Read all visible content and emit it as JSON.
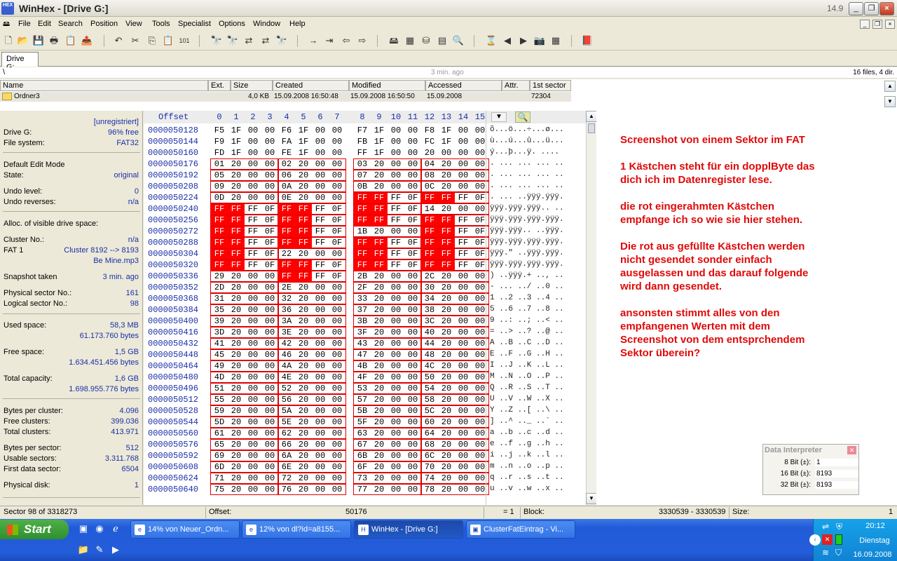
{
  "window": {
    "title": "WinHex - [Drive G:]",
    "version": "14.9",
    "app_icon_text": "HEX"
  },
  "menu": [
    "File",
    "Edit",
    "Search",
    "Position",
    "View",
    "Tools",
    "Specialist",
    "Options",
    "Window",
    "Help"
  ],
  "tab": "Drive G:",
  "pathbar": {
    "path": "\\",
    "time": "3 min. ago",
    "count": "16 files, 4 dir."
  },
  "filelist": {
    "headers": [
      "Name",
      "Ext.",
      "Size",
      "Created",
      "Modified",
      "Accessed",
      "Attr.",
      "1st sector"
    ],
    "row": {
      "name": "Ordner3",
      "size": "4,0 KB",
      "created": "15.09.2008  16:50:48",
      "modified": "15.09.2008  16:50:50",
      "accessed": "15.09.2008",
      "first_sector": "72304"
    }
  },
  "info": {
    "unregistered": "[unregistriert]",
    "drive_label": "Drive G:",
    "drive_free": "96% free",
    "fs_label": "File system:",
    "fs_value": "FAT32",
    "edit_mode": "Default Edit Mode",
    "state_label": "State:",
    "state_value": "original",
    "undo_level_label": "Undo level:",
    "undo_level": "0",
    "undo_rev_label": "Undo reverses:",
    "undo_rev": "n/a",
    "alloc": "Alloc. of visible drive space:",
    "cluster_no_label": "Cluster No.:",
    "cluster_no": "n/a",
    "fat1_label": "FAT 1",
    "fat1_value": "Cluster 8192 --> 8193",
    "fat1_file": "Be Mine.mp3",
    "snapshot_label": "Snapshot taken",
    "snapshot_value": "3 min. ago",
    "phys_label": "Physical sector No.:",
    "phys_value": "161",
    "log_label": "Logical sector No.:",
    "log_value": "98",
    "used_label": "Used space:",
    "used_1": "58,3 MB",
    "used_2": "61.173.760 bytes",
    "free_label": "Free space:",
    "free_1": "1,5 GB",
    "free_2": "1.634.451.456 bytes",
    "total_label": "Total capacity:",
    "total_1": "1,6 GB",
    "total_2": "1.698.955.776 bytes",
    "bpc_label": "Bytes per cluster:",
    "bpc": "4.096",
    "fc_label": "Free clusters:",
    "fc": "399.036",
    "tc_label": "Total clusters:",
    "tc": "413.971",
    "bps_label": "Bytes per sector:",
    "bps": "512",
    "us_label": "Usable sectors:",
    "us": "3.311.768",
    "fds_label": "First data sector:",
    "fds": "6504",
    "pd_label": "Physical disk:",
    "pd": "1"
  },
  "hex": {
    "offset_label": "Offset",
    "columns": [
      "0",
      "1",
      "2",
      "3",
      "4",
      "5",
      "6",
      "7",
      "8",
      "9",
      "10",
      "11",
      "12",
      "13",
      "14",
      "15"
    ],
    "rows": [
      {
        "off": "0000050128",
        "b": [
          "F5",
          "1F",
          "00",
          "00",
          "F6",
          "1F",
          "00",
          "00",
          "F7",
          "1F",
          "00",
          "00",
          "F8",
          "1F",
          "00",
          "00"
        ],
        "t": "õ...ö...÷...ø..."
      },
      {
        "off": "0000050144",
        "b": [
          "F9",
          "1F",
          "00",
          "00",
          "FA",
          "1F",
          "00",
          "00",
          "FB",
          "1F",
          "00",
          "00",
          "FC",
          "1F",
          "00",
          "00"
        ],
        "t": "ù...ú...û...ü..."
      },
      {
        "off": "0000050160",
        "b": [
          "FD",
          "1F",
          "00",
          "00",
          "FE",
          "1F",
          "00",
          "00",
          "FF",
          "1F",
          "00",
          "00",
          "20",
          "00",
          "00",
          "00"
        ],
        "t": "ý...þ...ÿ. ...."
      },
      {
        "off": "0000050176",
        "b": [
          "01",
          "20",
          "00",
          "00",
          "02",
          "20",
          "00",
          "00",
          "03",
          "20",
          "00",
          "00",
          "04",
          "20",
          "00",
          "00"
        ],
        "t": ". ... ... ... .."
      },
      {
        "off": "0000050192",
        "b": [
          "05",
          "20",
          "00",
          "00",
          "06",
          "20",
          "00",
          "00",
          "07",
          "20",
          "00",
          "00",
          "08",
          "20",
          "00",
          "00"
        ],
        "t": ". ... ... ... .."
      },
      {
        "off": "0000050208",
        "b": [
          "09",
          "20",
          "00",
          "00",
          "0A",
          "20",
          "00",
          "00",
          "0B",
          "20",
          "00",
          "00",
          "0C",
          "20",
          "00",
          "00"
        ],
        "t": ". ... ... ... .."
      },
      {
        "off": "0000050224",
        "b": [
          "0D",
          "20",
          "00",
          "00",
          "0E",
          "20",
          "00",
          "00",
          "FF",
          "FF",
          "FF",
          "0F",
          "FF",
          "FF",
          "FF",
          "0F"
        ],
        "t": ". ... ..ÿÿÿ.ÿÿÿ."
      },
      {
        "off": "0000050240",
        "b": [
          "FF",
          "FF",
          "FF",
          "0F",
          "FF",
          "FF",
          "FF",
          "0F",
          "FF",
          "FF",
          "FF",
          "0F",
          "14",
          "20",
          "00",
          "00"
        ],
        "t": "ÿÿÿ.ÿÿÿ.ÿÿÿ.. .."
      },
      {
        "off": "0000050256",
        "b": [
          "FF",
          "FF",
          "FF",
          "0F",
          "FF",
          "FF",
          "FF",
          "0F",
          "FF",
          "FF",
          "FF",
          "0F",
          "FF",
          "FF",
          "FF",
          "0F"
        ],
        "t": "ÿÿÿ.ÿÿÿ.ÿÿÿ.ÿÿÿ."
      },
      {
        "off": "0000050272",
        "b": [
          "FF",
          "FF",
          "FF",
          "0F",
          "FF",
          "FF",
          "FF",
          "0F",
          "1B",
          "20",
          "00",
          "00",
          "FF",
          "FF",
          "FF",
          "0F"
        ],
        "t": "ÿÿÿ.ÿÿÿ.. ..ÿÿÿ."
      },
      {
        "off": "0000050288",
        "b": [
          "FF",
          "FF",
          "FF",
          "0F",
          "FF",
          "FF",
          "FF",
          "0F",
          "FF",
          "FF",
          "FF",
          "0F",
          "FF",
          "FF",
          "FF",
          "0F"
        ],
        "t": "ÿÿÿ.ÿÿÿ.ÿÿÿ.ÿÿÿ."
      },
      {
        "off": "0000050304",
        "b": [
          "FF",
          "FF",
          "FF",
          "0F",
          "22",
          "20",
          "00",
          "00",
          "FF",
          "FF",
          "FF",
          "0F",
          "FF",
          "FF",
          "FF",
          "0F"
        ],
        "t": "ÿÿÿ.\" ..ÿÿÿ.ÿÿÿ."
      },
      {
        "off": "0000050320",
        "b": [
          "FF",
          "FF",
          "FF",
          "0F",
          "FF",
          "FF",
          "FF",
          "0F",
          "FF",
          "FF",
          "FF",
          "0F",
          "FF",
          "FF",
          "FF",
          "0F"
        ],
        "t": "ÿÿÿ.ÿÿÿ.ÿÿÿ.ÿÿÿ."
      },
      {
        "off": "0000050336",
        "b": [
          "29",
          "20",
          "00",
          "00",
          "FF",
          "FF",
          "FF",
          "0F",
          "2B",
          "20",
          "00",
          "00",
          "2C",
          "20",
          "00",
          "00"
        ],
        "t": ") ..ÿÿÿ.+ .., .."
      },
      {
        "off": "0000050352",
        "b": [
          "2D",
          "20",
          "00",
          "00",
          "2E",
          "20",
          "00",
          "00",
          "2F",
          "20",
          "00",
          "00",
          "30",
          "20",
          "00",
          "00"
        ],
        "t": "- ... ../ ..0 .."
      },
      {
        "off": "0000050368",
        "b": [
          "31",
          "20",
          "00",
          "00",
          "32",
          "20",
          "00",
          "00",
          "33",
          "20",
          "00",
          "00",
          "34",
          "20",
          "00",
          "00"
        ],
        "t": "1 ..2 ..3 ..4 .."
      },
      {
        "off": "0000050384",
        "b": [
          "35",
          "20",
          "00",
          "00",
          "36",
          "20",
          "00",
          "00",
          "37",
          "20",
          "00",
          "00",
          "38",
          "20",
          "00",
          "00"
        ],
        "t": "5 ..6 ..7 ..8 .."
      },
      {
        "off": "0000050400",
        "b": [
          "39",
          "20",
          "00",
          "00",
          "3A",
          "20",
          "00",
          "00",
          "3B",
          "20",
          "00",
          "00",
          "3C",
          "20",
          "00",
          "00"
        ],
        "t": "9 ..: ..; ..< .."
      },
      {
        "off": "0000050416",
        "b": [
          "3D",
          "20",
          "00",
          "00",
          "3E",
          "20",
          "00",
          "00",
          "3F",
          "20",
          "00",
          "00",
          "40",
          "20",
          "00",
          "00"
        ],
        "t": "= ..> ..? ..@ .."
      },
      {
        "off": "0000050432",
        "b": [
          "41",
          "20",
          "00",
          "00",
          "42",
          "20",
          "00",
          "00",
          "43",
          "20",
          "00",
          "00",
          "44",
          "20",
          "00",
          "00"
        ],
        "t": "A ..B ..C ..D .."
      },
      {
        "off": "0000050448",
        "b": [
          "45",
          "20",
          "00",
          "00",
          "46",
          "20",
          "00",
          "00",
          "47",
          "20",
          "00",
          "00",
          "48",
          "20",
          "00",
          "00"
        ],
        "t": "E ..F ..G ..H .."
      },
      {
        "off": "0000050464",
        "b": [
          "49",
          "20",
          "00",
          "00",
          "4A",
          "20",
          "00",
          "00",
          "4B",
          "20",
          "00",
          "00",
          "4C",
          "20",
          "00",
          "00"
        ],
        "t": "I ..J ..K ..L .."
      },
      {
        "off": "0000050480",
        "b": [
          "4D",
          "20",
          "00",
          "00",
          "4E",
          "20",
          "00",
          "00",
          "4F",
          "20",
          "00",
          "00",
          "50",
          "20",
          "00",
          "00"
        ],
        "t": "M ..N ..O ..P .."
      },
      {
        "off": "0000050496",
        "b": [
          "51",
          "20",
          "00",
          "00",
          "52",
          "20",
          "00",
          "00",
          "53",
          "20",
          "00",
          "00",
          "54",
          "20",
          "00",
          "00"
        ],
        "t": "Q ..R ..S ..T .."
      },
      {
        "off": "0000050512",
        "b": [
          "55",
          "20",
          "00",
          "00",
          "56",
          "20",
          "00",
          "00",
          "57",
          "20",
          "00",
          "00",
          "58",
          "20",
          "00",
          "00"
        ],
        "t": "U ..V ..W ..X .."
      },
      {
        "off": "0000050528",
        "b": [
          "59",
          "20",
          "00",
          "00",
          "5A",
          "20",
          "00",
          "00",
          "5B",
          "20",
          "00",
          "00",
          "5C",
          "20",
          "00",
          "00"
        ],
        "t": "Y ..Z ..[ ..\\ .."
      },
      {
        "off": "0000050544",
        "b": [
          "5D",
          "20",
          "00",
          "00",
          "5E",
          "20",
          "00",
          "00",
          "5F",
          "20",
          "00",
          "00",
          "60",
          "20",
          "00",
          "00"
        ],
        "t": "] ..^ .._ ..` .."
      },
      {
        "off": "0000050560",
        "b": [
          "61",
          "20",
          "00",
          "00",
          "62",
          "20",
          "00",
          "00",
          "63",
          "20",
          "00",
          "00",
          "64",
          "20",
          "00",
          "00"
        ],
        "t": "a ..b ..c ..d .."
      },
      {
        "off": "0000050576",
        "b": [
          "65",
          "20",
          "00",
          "00",
          "66",
          "20",
          "00",
          "00",
          "67",
          "20",
          "00",
          "00",
          "68",
          "20",
          "00",
          "00"
        ],
        "t": "e ..f ..g ..h .."
      },
      {
        "off": "0000050592",
        "b": [
          "69",
          "20",
          "00",
          "00",
          "6A",
          "20",
          "00",
          "00",
          "6B",
          "20",
          "00",
          "00",
          "6C",
          "20",
          "00",
          "00"
        ],
        "t": "i ..j ..k ..l .."
      },
      {
        "off": "0000050608",
        "b": [
          "6D",
          "20",
          "00",
          "00",
          "6E",
          "20",
          "00",
          "00",
          "6F",
          "20",
          "00",
          "00",
          "70",
          "20",
          "00",
          "00"
        ],
        "t": "m ..n ..o ..p .."
      },
      {
        "off": "0000050624",
        "b": [
          "71",
          "20",
          "00",
          "00",
          "72",
          "20",
          "00",
          "00",
          "73",
          "20",
          "00",
          "00",
          "74",
          "20",
          "00",
          "00"
        ],
        "t": "q ..r ..s ..t .."
      },
      {
        "off": "0000050640",
        "b": [
          "75",
          "20",
          "00",
          "00",
          "76",
          "20",
          "00",
          "00",
          "77",
          "20",
          "00",
          "00",
          "78",
          "20",
          "00",
          "00"
        ],
        "t": "u ..v ..w ..x .."
      }
    ],
    "filled_bytes": [
      [
        6,
        8
      ],
      [
        6,
        9
      ],
      [
        6,
        12
      ],
      [
        6,
        13
      ],
      [
        7,
        0
      ],
      [
        7,
        1
      ],
      [
        7,
        4
      ],
      [
        7,
        5
      ],
      [
        7,
        8
      ],
      [
        7,
        9
      ],
      [
        8,
        0
      ],
      [
        8,
        1
      ],
      [
        8,
        4
      ],
      [
        8,
        5
      ],
      [
        8,
        8
      ],
      [
        8,
        9
      ],
      [
        8,
        12
      ],
      [
        8,
        13
      ],
      [
        9,
        0
      ],
      [
        9,
        1
      ],
      [
        9,
        4
      ],
      [
        9,
        5
      ],
      [
        9,
        12
      ],
      [
        9,
        13
      ],
      [
        10,
        0
      ],
      [
        10,
        1
      ],
      [
        10,
        4
      ],
      [
        10,
        5
      ],
      [
        10,
        8
      ],
      [
        10,
        9
      ],
      [
        10,
        12
      ],
      [
        10,
        13
      ],
      [
        11,
        0
      ],
      [
        11,
        1
      ],
      [
        11,
        8
      ],
      [
        11,
        9
      ],
      [
        11,
        12
      ],
      [
        11,
        13
      ],
      [
        12,
        0
      ],
      [
        12,
        1
      ],
      [
        12,
        4
      ],
      [
        12,
        5
      ],
      [
        12,
        8
      ],
      [
        12,
        9
      ],
      [
        12,
        12
      ],
      [
        12,
        13
      ],
      [
        13,
        4
      ],
      [
        13,
        5
      ]
    ],
    "boxed_from_row": 3,
    "fill_color": "#ff0000",
    "box_color": "#e00000"
  },
  "note": [
    "Screenshot von einem Sektor im FAT",
    "1 Kästchen steht für ein dopplByte das dich ich im Datenregister lese.",
    "die rot eingerahmten Kästchen empfange ich so wie sie hier stehen.",
    "Die rot aus gefüllte Kästchen werden nicht gesendet sonder einfach ausgelassen und das darauf folgende wird dann gesendet.",
    "ansonsten stimmt alles von den empfangenen Werten mit dem Screenshot von dem entsprchendem Sektor überein?"
  ],
  "interpreter": {
    "title": "Data Interpreter",
    "rows": [
      {
        "k": "8 Bit (±):",
        "v": "1"
      },
      {
        "k": "16 Bit (±):",
        "v": "8193"
      },
      {
        "k": "32 Bit (±):",
        "v": "8193"
      }
    ]
  },
  "status": {
    "sector": "Sector 98 of 3318273",
    "offset_label": "Offset:",
    "offset": "50176",
    "eq": "= 1",
    "block_label": "Block:",
    "block": "3330539 - 3330539",
    "size_label": "Size:",
    "size": "1"
  },
  "taskbar": {
    "start": "Start",
    "tasks": [
      "14% von Neuer_Ordn...",
      "12% von dl?id=a8155...",
      "WinHex - [Drive G:]",
      "ClusterFatEintrag - Vi..."
    ],
    "time": "20:12",
    "day": "Dienstag",
    "date": "16.09.2008"
  }
}
